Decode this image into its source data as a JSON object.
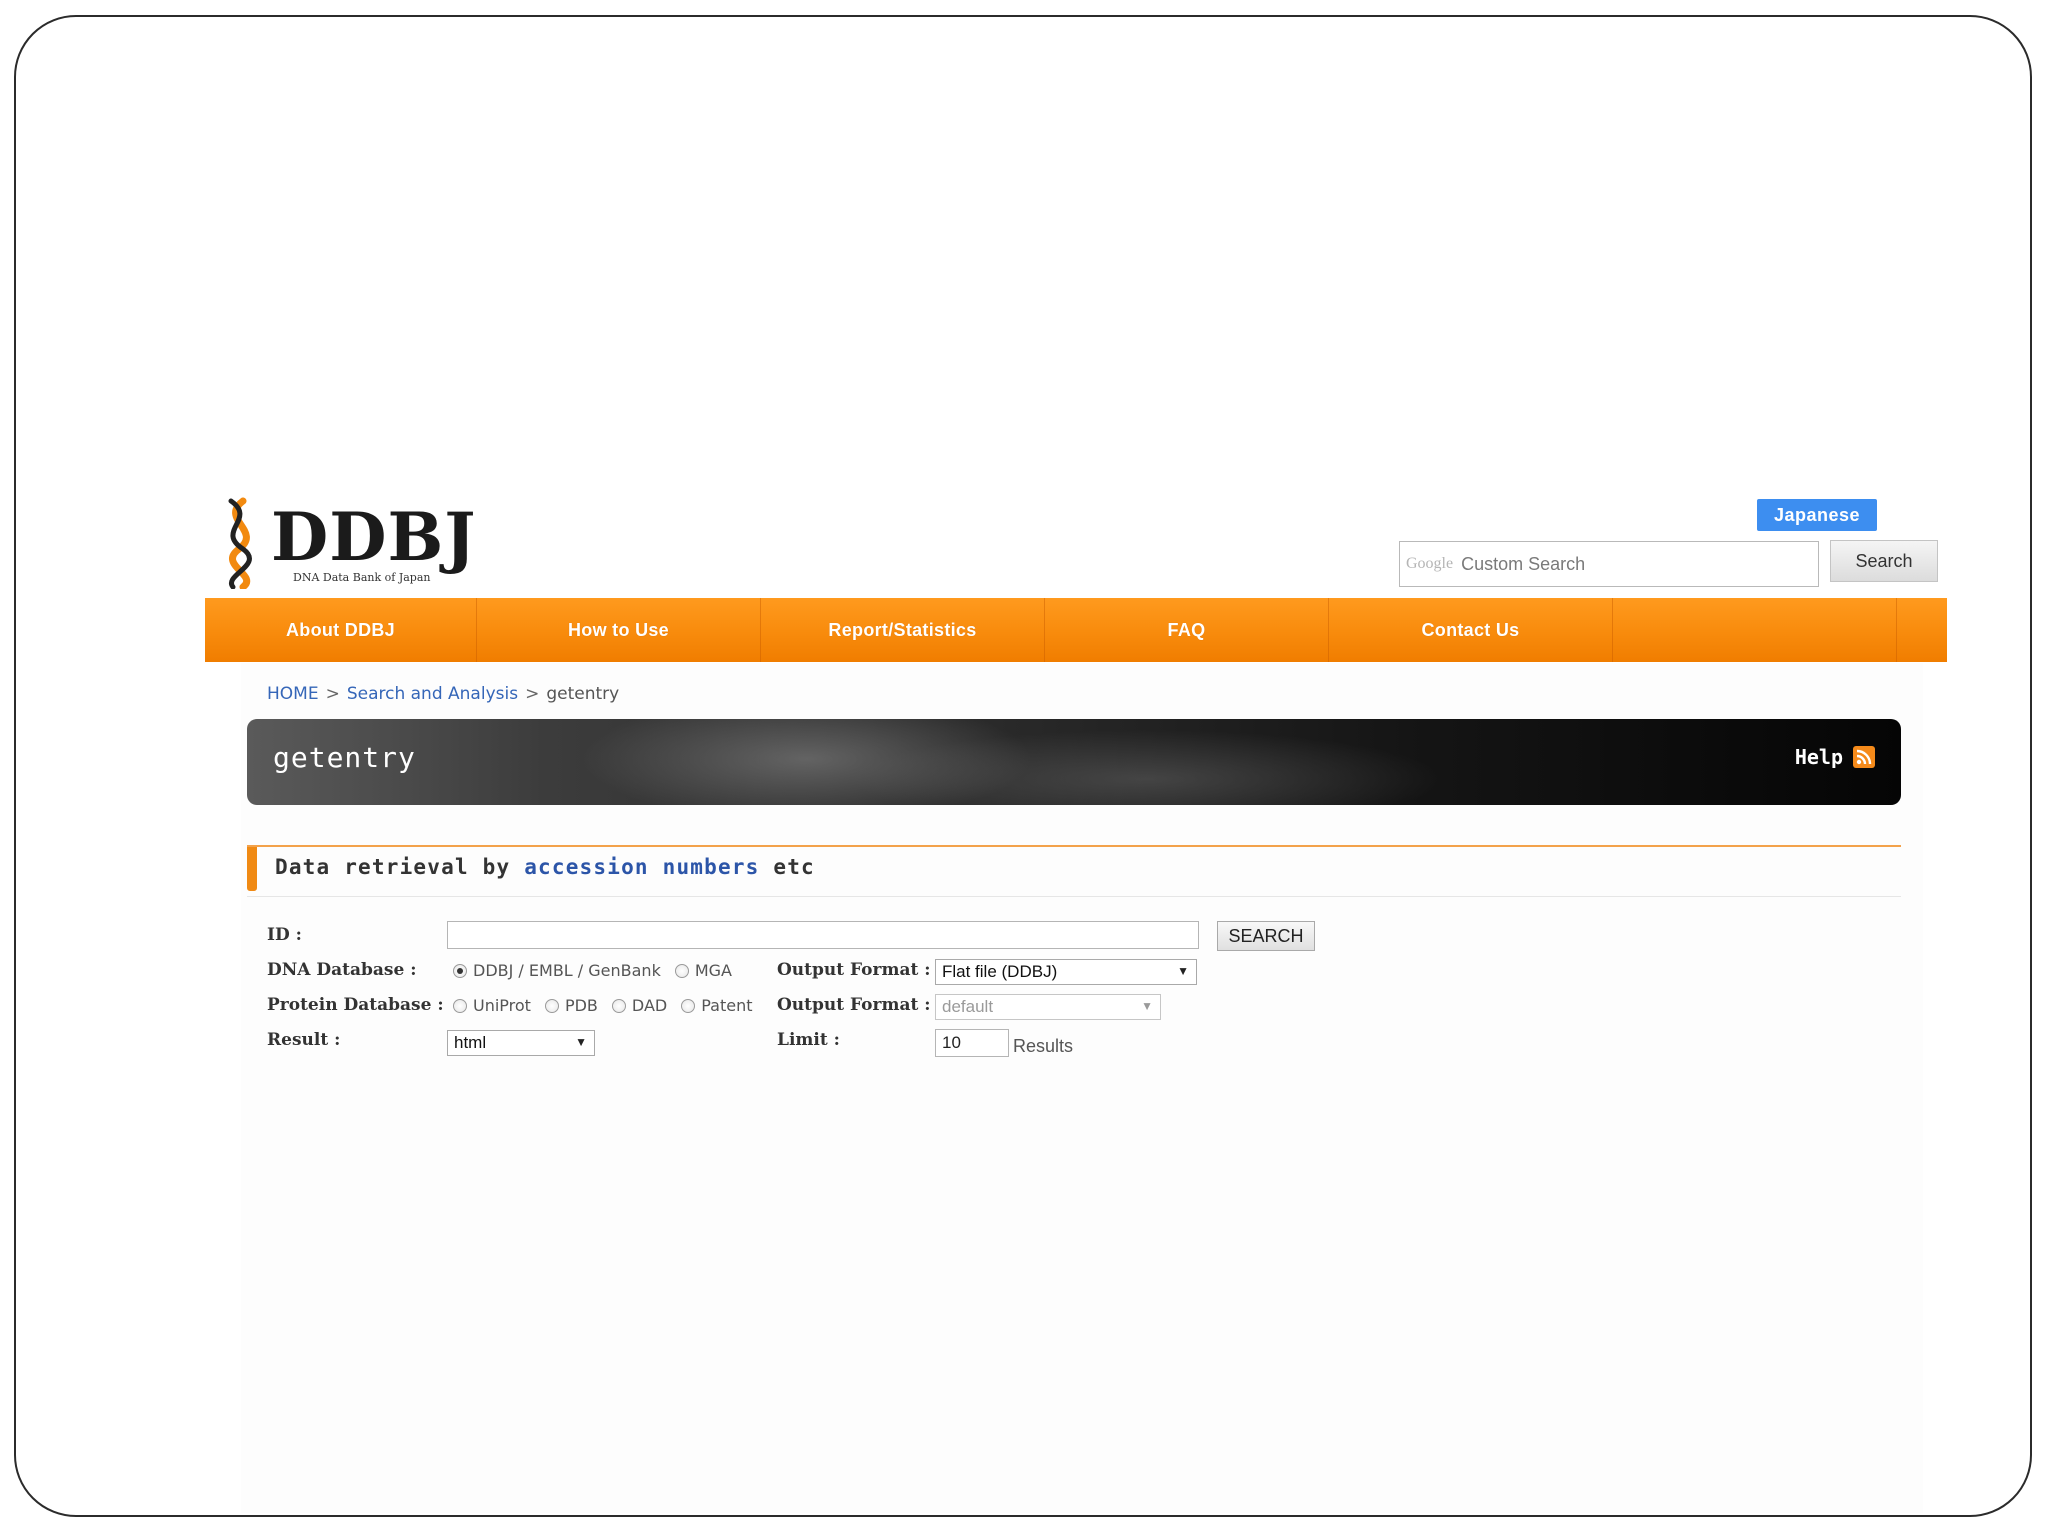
{
  "header": {
    "logo_text": "DDBJ",
    "logo_subtitle": "DNA Data Bank of Japan",
    "language_button": "Japanese",
    "search": {
      "google_mark": "Google",
      "placeholder": "Custom Search",
      "button_label": "Search"
    }
  },
  "nav": {
    "items": [
      {
        "label": "About DDBJ"
      },
      {
        "label": "How to Use"
      },
      {
        "label": "Report/Statistics"
      },
      {
        "label": "FAQ"
      },
      {
        "label": "Contact Us"
      }
    ]
  },
  "breadcrumb": {
    "home": "HOME",
    "separator": ">",
    "section": "Search and Analysis",
    "current": "getentry"
  },
  "title_bar": {
    "title": "getentry",
    "help": "Help",
    "help_icon": "rss-icon"
  },
  "section": {
    "title_prefix": "Data retrieval by",
    "title_highlight": "accession numbers",
    "title_suffix": "etc"
  },
  "form": {
    "id_label": "ID :",
    "id_value": "",
    "search_button": "SEARCH",
    "dna_label": "DNA Database :",
    "dna_options": [
      {
        "label": "DDBJ / EMBL / GenBank",
        "checked": true
      },
      {
        "label": "MGA",
        "checked": false
      }
    ],
    "dna_output_label": "Output Format :",
    "dna_output_value": "Flat file (DDBJ)",
    "protein_label": "Protein Database :",
    "protein_options": [
      {
        "label": "UniProt",
        "checked": false
      },
      {
        "label": "PDB",
        "checked": false
      },
      {
        "label": "DAD",
        "checked": false
      },
      {
        "label": "Patent",
        "checked": false
      }
    ],
    "protein_output_label": "Output Format :",
    "protein_output_value": "default",
    "result_label": "Result :",
    "result_value": "html",
    "limit_label": "Limit :",
    "limit_value": "10",
    "results_suffix": "Results"
  },
  "colors": {
    "nav_orange": "#f88b0c",
    "link_blue": "#3566b8",
    "language_blue": "#3d8ef0"
  }
}
